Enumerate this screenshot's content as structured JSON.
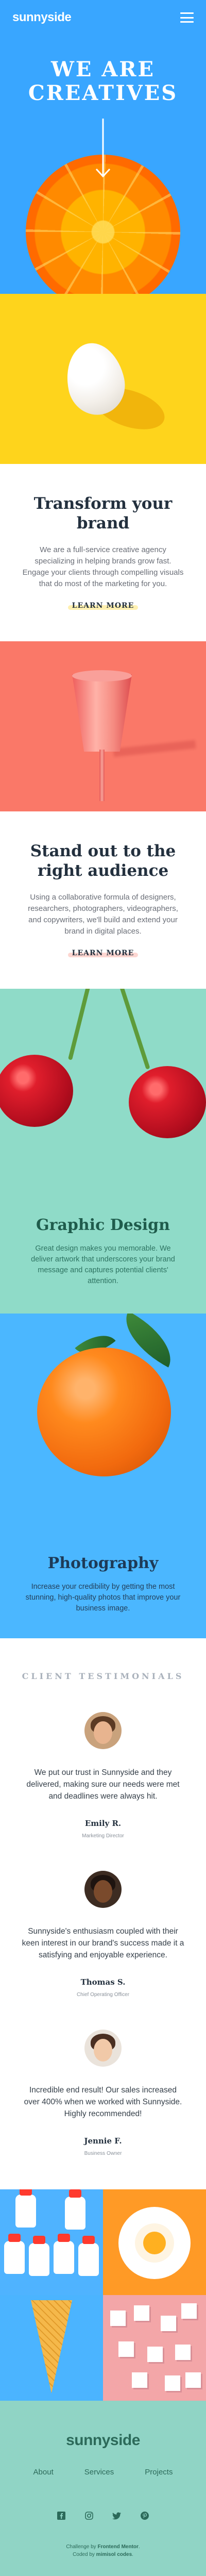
{
  "header": {
    "logo": "sunnyside",
    "menu_icon": "hamburger-icon"
  },
  "hero": {
    "title": "WE ARE CREATIVES",
    "arrow_icon": "arrow-down-icon"
  },
  "sections": [
    {
      "title": "Transform your brand",
      "body": "We are a full-service creative agency specializing in helping brands grow fast. Engage your clients through compelling visuals that do most of the marketing for you.",
      "link": "LEARN MORE",
      "accent": "#fed41c"
    },
    {
      "title": "Stand out to the right audience",
      "body": "Using a collaborative formula of designers, researchers, photographers, videographers, and copywriters, we'll build and extend your brand in digital places.",
      "link": "LEARN MORE",
      "accent": "#fa7868"
    }
  ],
  "features": [
    {
      "title": "Graphic Design",
      "body": "Great design makes you memorable. We deliver artwork that underscores your brand message and captures potential clients' attention."
    },
    {
      "title": "Photography",
      "body": "Increase your credibility by getting the most stunning, high-quality photos that improve your business image."
    }
  ],
  "testimonials": {
    "heading": "CLIENT TESTIMONIALS",
    "items": [
      {
        "quote": "We put our trust in Sunnyside and they delivered, making sure our needs were met and deadlines were always hit.",
        "name": "Emily R.",
        "role": "Marketing Director"
      },
      {
        "quote": "Sunnyside's enthusiasm coupled with their keen interest in our brand's success made it a satisfying and enjoyable experience.",
        "name": "Thomas S.",
        "role": "Chief Operating Officer"
      },
      {
        "quote": "Incredible end result! Our sales increased over 400% when we worked with Sunnyside. Highly recommended!",
        "name": "Jennie F.",
        "role": "Business Owner"
      }
    ]
  },
  "footer": {
    "logo": "sunnyside",
    "links": [
      "About",
      "Services",
      "Projects"
    ],
    "social_icons": [
      "facebook-icon",
      "instagram-icon",
      "twitter-icon",
      "pinterest-icon"
    ],
    "attribution_prefix": "Challenge by",
    "attribution_challenge": "Frontend Mentor",
    "attribution_coded_prefix": "Coded by",
    "attribution_author": "mimisol codes"
  },
  "colors": {
    "hero_bg": "#39a6ff",
    "yellow": "#fed41c",
    "soft_red": "#fa7868",
    "dark_cyan": "#90d4c5",
    "photo_bg": "#4bb7ff",
    "heading_dark": "#23303e"
  }
}
